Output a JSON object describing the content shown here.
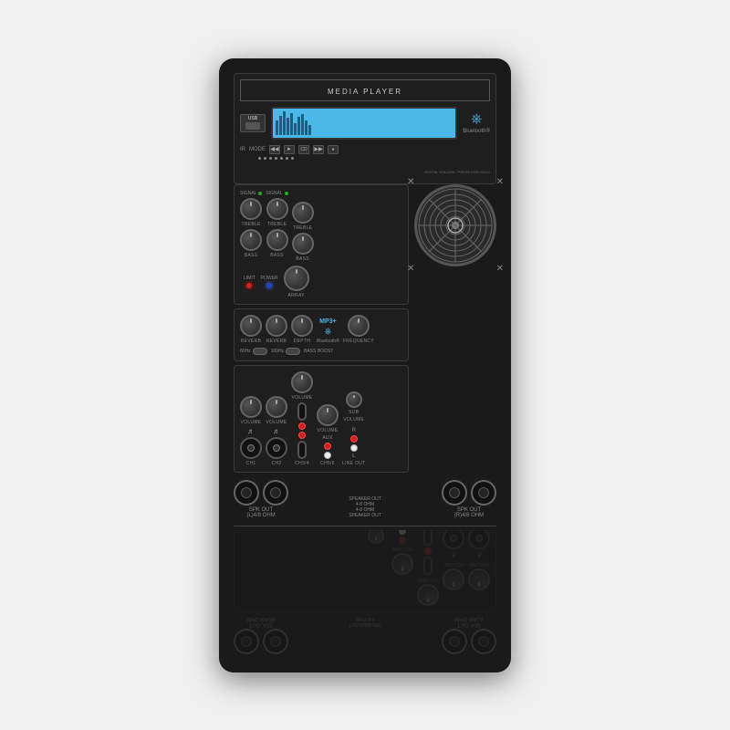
{
  "device": {
    "title": "MEDIA PLAYER",
    "bluetooth_label": "Bluetooth®",
    "usb_label": "USB",
    "ir_label": "IR",
    "mode_label": "MODE",
    "limit_label": "LIMIT",
    "power_label": "POWER",
    "array_label": "ARRAY",
    "bass_boost_label": "BASS BOOST",
    "freq_80hz": "80Hz",
    "freq_100hz": "100Hz",
    "mp3_label": "MP3+",
    "bluetooth2_label": "Bluetooth®",
    "channels": {
      "ch1_label": "CH1",
      "ch2_label": "CH2",
      "ch3_label": "CH3/4",
      "ch4_label": "CH5/6",
      "line_out_label": "LINE OUT"
    },
    "knobs": {
      "signal": "SIGNAL",
      "treble": "TREBLE",
      "bass": "BASS",
      "reverb": "REVERB",
      "depth": "DEPTH",
      "volume": "VOLUME",
      "frequency": "FREQUENCY",
      "sub_volume": "SUB VOLUME"
    },
    "spk_out_l": "SPK OUT\n(L)4/8 OHM",
    "spk_out_r": "SPK OUT\n(R)4/8 OHM",
    "aux_label": "AUX",
    "digital_volume_label": "DIGITAL VOLUME\nPRESS FOR HOLD",
    "speaker_out_label": "SPEAKER OUT\n4-8 OHM\n4-8 OHM\nSPEAKER OUT"
  }
}
